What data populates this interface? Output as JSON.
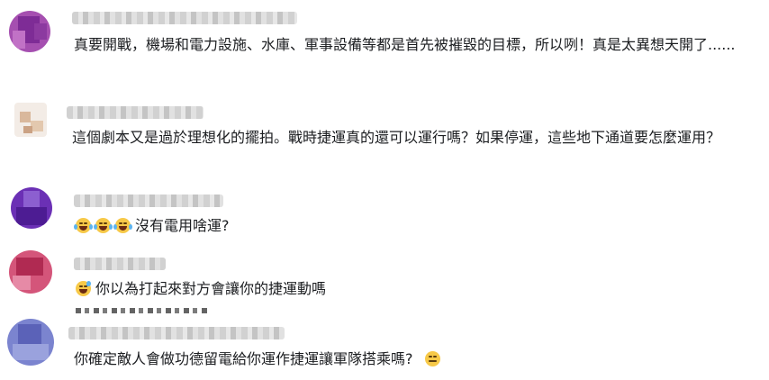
{
  "comments": [
    {
      "text": "真要開戰，機場和電力設施、水庫、軍事設備等都是首先被摧毀的目標，所以咧！真是太異想天開了......",
      "avatar_color": "#9b3fa8"
    },
    {
      "text": "這個劇本又是過於理想化的擺拍。戰時捷運真的還可以運行嗎？如果停運，這些地下通道要怎麼運用？",
      "avatar_color": "#d6b9a0"
    },
    {
      "text": "沒有電用啥運?",
      "emoji": [
        "face-with-tears-of-joy-icon",
        "face-with-tears-of-joy-icon",
        "face-with-tears-of-joy-icon"
      ],
      "avatar_color": "#6a2fb0"
    },
    {
      "text": "你以為打起來對方會讓你的捷運動嗎",
      "emoji": [
        "grinning-sweat-icon"
      ],
      "avatar_color": "#c23a5e"
    },
    {
      "text": "你確定敵人會做功德留電給你運作捷運讓軍隊搭乘嗎?",
      "emoji_after": "expressionless-face-icon",
      "avatar_color": "#6f78c8"
    }
  ]
}
